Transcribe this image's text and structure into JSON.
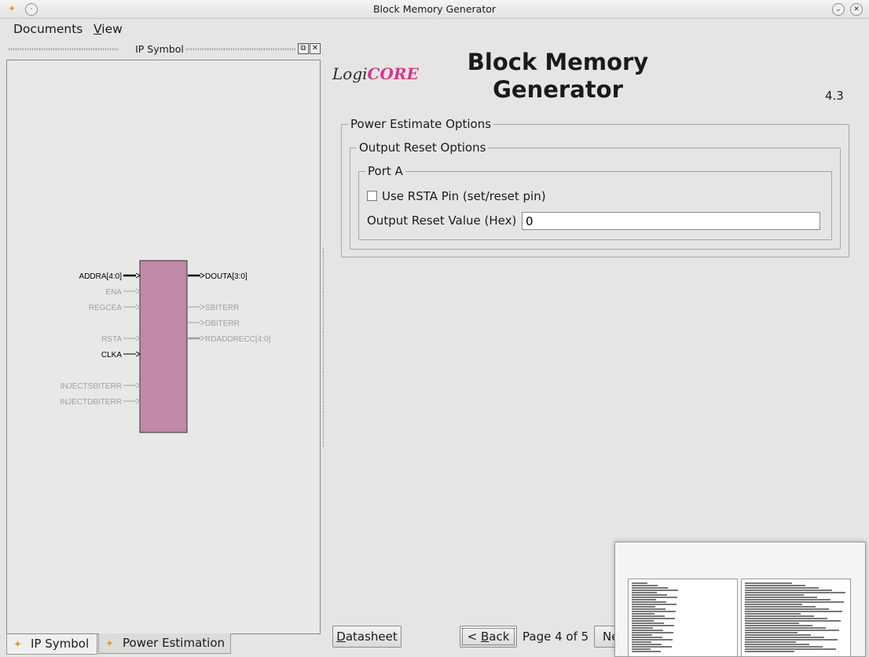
{
  "window": {
    "title": "Block Memory Generator"
  },
  "menu": {
    "documents": "Documents",
    "view_prefix": "V",
    "view_rest": "iew"
  },
  "ip_symbol_panel": {
    "title": "IP Symbol",
    "ports_left": [
      {
        "label": "ADDRA[4:0]",
        "active": true
      },
      {
        "label": "ENA",
        "active": false
      },
      {
        "label": "REGCEA",
        "active": false
      },
      {
        "label": "RSTA",
        "active": false
      },
      {
        "label": "CLKA",
        "active": true
      },
      {
        "label": "INJECTSBITERR",
        "active": false
      },
      {
        "label": "INJECTDBITERR",
        "active": false
      }
    ],
    "ports_right": [
      {
        "label": "DOUTA[3:0]",
        "active": true
      },
      {
        "label": "SBITERR",
        "active": false
      },
      {
        "label": "DBITERR",
        "active": false
      },
      {
        "label": "RDADDRECC[4:0]",
        "active": false
      }
    ],
    "block_color": "#c089a8"
  },
  "bottom_tabs": {
    "ip_symbol": "IP Symbol",
    "power_estimation": "Power Estimation"
  },
  "header": {
    "logo_logi": "Logi",
    "logo_core": "CORE",
    "title_line1": "Block Memory",
    "title_line2": "Generator",
    "version": "4.3"
  },
  "options": {
    "power_estimate_legend": "Power Estimate Options",
    "output_reset_legend": "Output Reset Options",
    "port_a_legend": "Port A",
    "use_rsta_label": "Use RSTA Pin (set/reset pin)",
    "use_rsta_checked": false,
    "reset_value_label": "Output Reset Value (Hex)",
    "reset_value": "0"
  },
  "footer": {
    "datasheet_prefix": "D",
    "datasheet_rest": "atasheet",
    "back_prefix": "< ",
    "back_accel": "B",
    "back_rest": "ack",
    "page_info": "Page 4 of 5",
    "next_label": "Next"
  }
}
